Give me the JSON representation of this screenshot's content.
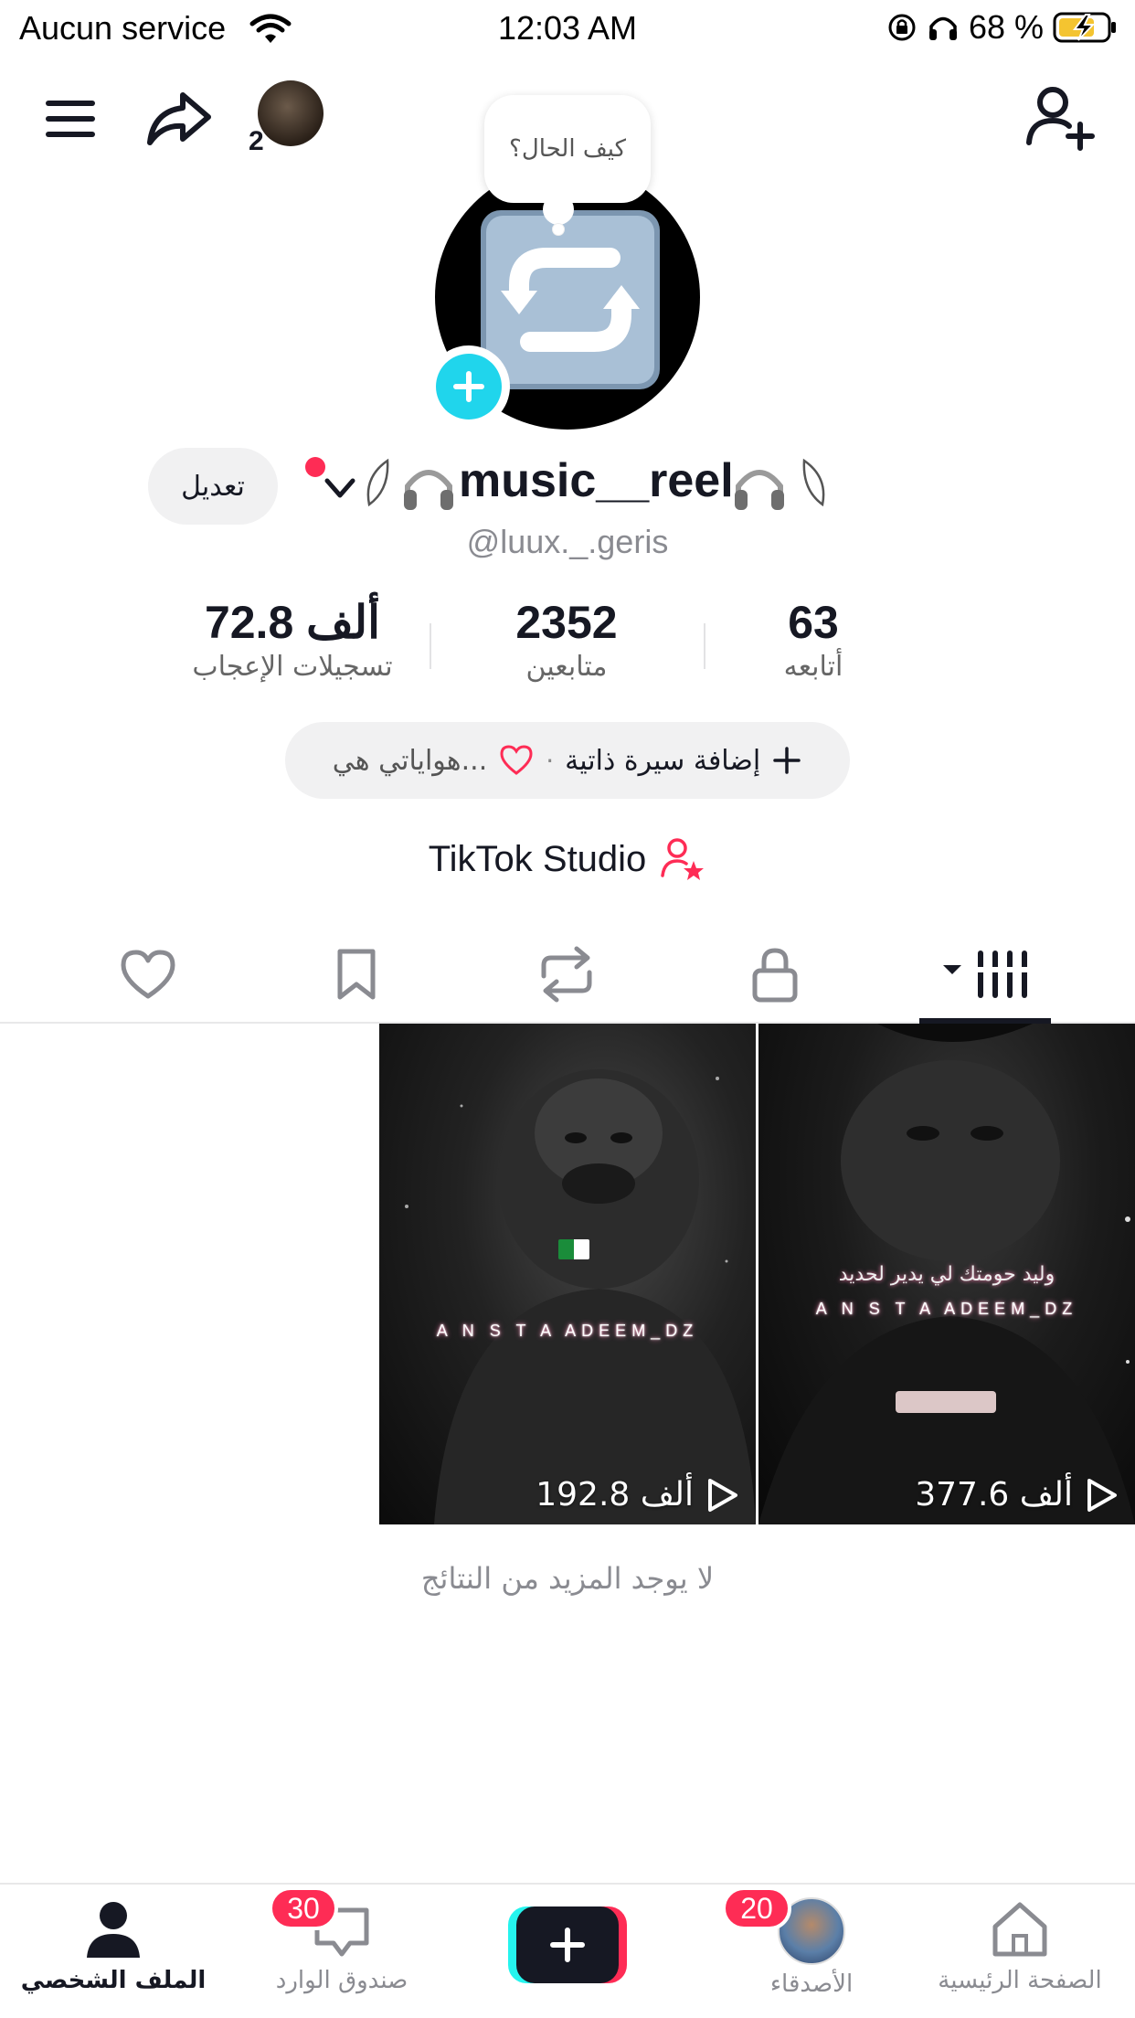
{
  "status_bar": {
    "carrier": "Aucun service",
    "time": "12:03 AM",
    "battery_percent": "68 %"
  },
  "top_bar": {
    "friend_count": "2"
  },
  "speech_bubble": "كيف الحال؟",
  "profile": {
    "display_name": "music__reel",
    "username": "@luux._.geris",
    "edit_label": "تعديل"
  },
  "stats": {
    "likes": {
      "value": "72.8 ألف",
      "label": "تسجيلات الإعجاب"
    },
    "followers": {
      "value": "2352",
      "label": "متابعين"
    },
    "following": {
      "value": "63",
      "label": "أتابعه"
    }
  },
  "bio": {
    "add_label": "إضافة سيرة ذاتية",
    "separator": "·",
    "hobbies_label": "هواياتي هي..."
  },
  "studio_label": "TikTok Studio",
  "videos": [
    {
      "views": "192.8 ألف",
      "caption": "A N S T A ADEEM_DZ"
    },
    {
      "views": "377.6 ألف",
      "caption": "A N S T A ADEEM_DZ",
      "arabic_caption": "وليد حومتك لي يدير لحديد"
    }
  ],
  "no_more_results": "لا يوجد المزيد من النتائج",
  "bottom_nav": {
    "home": "الصفحة الرئيسية",
    "friends": "الأصدقاء",
    "friends_badge": "20",
    "inbox": "صندوق الوارد",
    "inbox_badge": "30",
    "profile": "الملف الشخصي"
  },
  "colors": {
    "accent_red": "#fe2c55",
    "accent_cyan": "#25f4ee",
    "avatar_add": "#20d5ec",
    "text_primary": "#161823",
    "text_secondary": "#8a8b91"
  },
  "icons": [
    "menu-icon",
    "share-icon",
    "add-friend-icon",
    "heart-icon",
    "bookmark-icon",
    "repost-icon",
    "lock-icon",
    "grid-icon",
    "play-icon",
    "home-icon",
    "inbox-icon",
    "profile-icon",
    "plus-icon"
  ]
}
